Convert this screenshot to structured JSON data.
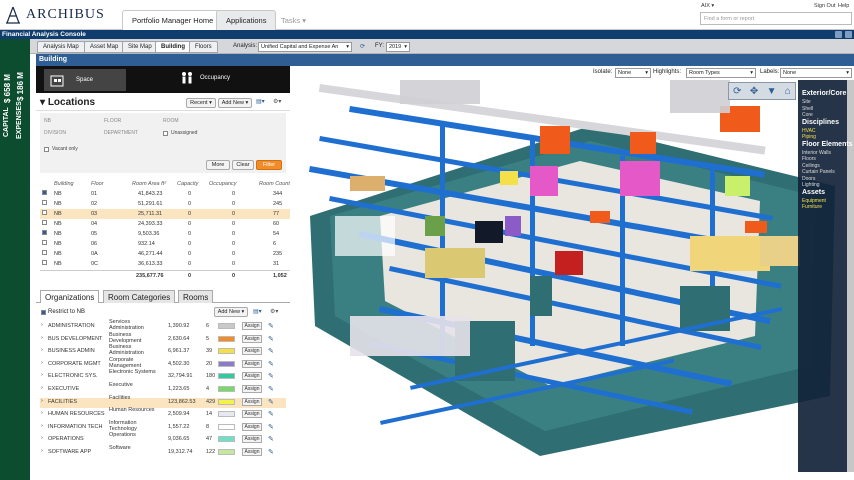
{
  "app": {
    "logo_text": "ARCHIBUS",
    "console_title": "Financial Analysis Console"
  },
  "topnav": {
    "home_tab": "Portfolio Manager Home",
    "apps_tab": "Applications",
    "tasks_tab": "Tasks",
    "user": "AIX",
    "signout": "Sign Out",
    "help": "Help",
    "search_placeholder": "Find a form or report"
  },
  "sidestrip": {
    "capital_label": "CAPITAL",
    "capital_value": "$ 658 M",
    "expenses_label": "EXPENSES",
    "expenses_value": "$ 186 M"
  },
  "subtabs": [
    {
      "label": "Analysis Map",
      "active": false
    },
    {
      "label": "Asset Map",
      "active": false
    },
    {
      "label": "Site Map",
      "active": false
    },
    {
      "label": "Building",
      "active": true
    },
    {
      "label": "Floors",
      "active": false
    }
  ],
  "analysis": {
    "label": "Analysis:",
    "value": "Unified Capital and Expense An",
    "fy_label": "FY:",
    "fy_value": "2019"
  },
  "section_title": "Building",
  "modes": {
    "space": "Space",
    "occupancy": "Occupancy"
  },
  "locations": {
    "title": "Locations",
    "recent": "Recent",
    "add_new": "Add New",
    "filter": {
      "nb": "NB",
      "floor": "FLOOR",
      "room": "ROOM",
      "division": "DIVISION",
      "department": "DEPARTMENT",
      "unassigned": "Unassigned",
      "vacant_only": "Vacant only",
      "more": "More",
      "clear": "Clear",
      "filter": "Filter"
    },
    "columns": [
      "Building",
      "Floor",
      "Room Area ft²",
      "Capacity",
      "Occupancy",
      "Room Count"
    ],
    "rows": [
      {
        "bldg": "NB",
        "floor": "01",
        "area": "41,843.23",
        "cap": "0",
        "occ": "0",
        "count": "344",
        "checked": true,
        "hl": false
      },
      {
        "bldg": "NB",
        "floor": "02",
        "area": "51,291.61",
        "cap": "0",
        "occ": "0",
        "count": "245",
        "checked": false,
        "hl": false
      },
      {
        "bldg": "NB",
        "floor": "03",
        "area": "25,711.31",
        "cap": "0",
        "occ": "0",
        "count": "77",
        "checked": false,
        "hl": true
      },
      {
        "bldg": "NB",
        "floor": "04",
        "area": "24,393.33",
        "cap": "0",
        "occ": "0",
        "count": "60",
        "checked": false,
        "hl": false
      },
      {
        "bldg": "NB",
        "floor": "05",
        "area": "9,503.36",
        "cap": "0",
        "occ": "0",
        "count": "54",
        "checked": true,
        "hl": false
      },
      {
        "bldg": "NB",
        "floor": "06",
        "area": "932.14",
        "cap": "0",
        "occ": "0",
        "count": "6",
        "checked": false,
        "hl": false
      },
      {
        "bldg": "NB",
        "floor": "0A",
        "area": "46,271.44",
        "cap": "0",
        "occ": "0",
        "count": "235",
        "checked": false,
        "hl": false
      },
      {
        "bldg": "NB",
        "floor": "0C",
        "area": "36,613.33",
        "cap": "0",
        "occ": "0",
        "count": "31",
        "checked": false,
        "hl": false
      }
    ],
    "totals": {
      "area": "235,677.76",
      "cap": "0",
      "occ": "0",
      "count": "1,052"
    }
  },
  "org": {
    "tabs": [
      "Organizations",
      "Room Categories",
      "Rooms"
    ],
    "restrict": "Restrict to NB",
    "add_new": "Add New",
    "assign": "Assign",
    "rows": [
      {
        "name": "ADMINISTRATION",
        "desc": "Services Administration",
        "area": "1,390.92",
        "count": "6",
        "color": "#c9c9c9",
        "hl": false
      },
      {
        "name": "BUS DEVELOPMENT",
        "desc": "Business Development",
        "area": "2,630.64",
        "count": "5",
        "color": "#f28c28",
        "hl": false
      },
      {
        "name": "BUSINESS ADMIN",
        "desc": "Business Administration",
        "area": "6,961.37",
        "count": "39",
        "color": "#f5e04a",
        "hl": false
      },
      {
        "name": "CORPORATE MGMT",
        "desc": "Corporate Management",
        "area": "4,502.30",
        "count": "20",
        "color": "#8b7cc8",
        "hl": false
      },
      {
        "name": "ELECTRONIC SYS.",
        "desc": "Electronic Systems",
        "area": "32,794.91",
        "count": "180",
        "color": "#33c9a0",
        "hl": false
      },
      {
        "name": "EXECUTIVE",
        "desc": "Executive",
        "area": "1,223.65",
        "count": "4",
        "color": "#79d86a",
        "hl": false
      },
      {
        "name": "FACILITIES",
        "desc": "Facilities",
        "area": "123,862.53",
        "count": "429",
        "color": "#f2f24a",
        "hl": true
      },
      {
        "name": "HUMAN RESOURCES",
        "desc": "Human Resources",
        "area": "2,509.94",
        "count": "14",
        "color": "#e8e8f0",
        "hl": false
      },
      {
        "name": "INFORMATION TECH",
        "desc": "Information Technology",
        "area": "1,557.22",
        "count": "8",
        "color": "#ffffff",
        "hl": false
      },
      {
        "name": "OPERATIONS",
        "desc": "Operations",
        "area": "9,036.65",
        "count": "47",
        "color": "#6ee0c8",
        "hl": false
      },
      {
        "name": "SOFTWARE APP",
        "desc": "Software",
        "area": "19,312.74",
        "count": "122",
        "color": "#c4e8a0",
        "hl": false
      }
    ]
  },
  "viewer": {
    "isolate_label": "Isolate:",
    "isolate_value": "None",
    "highlights_label": "Highlights:",
    "highlights_value": "Room Types",
    "labels_label": "Labels:",
    "labels_value": "None"
  },
  "layers": {
    "exterior_title": "Exterior/Core",
    "exterior": [
      "Site",
      "Shell",
      "Core"
    ],
    "disciplines_title": "Disciplines",
    "disciplines": [
      "HVAC",
      "Piping"
    ],
    "floor_title": "Floor Elements",
    "floor": [
      "Interior Walls",
      "Floors",
      "Ceilings",
      "Curtain Panels",
      "Doors",
      "Lighting"
    ],
    "assets_title": "Assets",
    "assets": [
      "Equipment",
      "Furniture"
    ]
  }
}
